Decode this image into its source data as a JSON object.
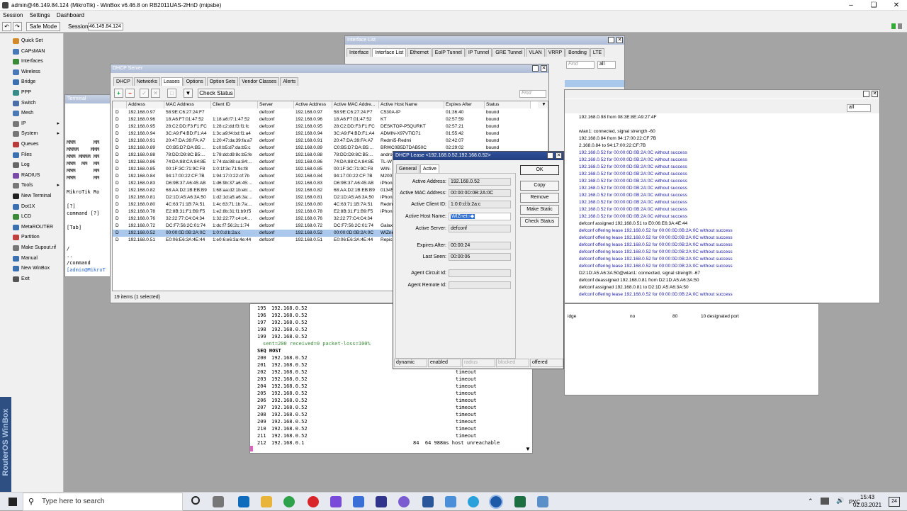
{
  "window": {
    "title": "admin@46.149.84.124 (MikroTik) - WinBox v6.46.8 on RB2011UAS-2HnD (mipsbe)"
  },
  "menu": [
    "Session",
    "Settings",
    "Dashboard"
  ],
  "toolbar": {
    "safe_mode": "Safe Mode",
    "session_label": "Session:",
    "session_value": "46.149.84.124"
  },
  "sidebar": [
    {
      "label": "Quick Set",
      "color": "#d08a2a",
      "sub": ""
    },
    {
      "label": "CAPsMAN",
      "color": "#4a79b8",
      "sub": ""
    },
    {
      "label": "Interfaces",
      "color": "#3a8a3a",
      "sub": ""
    },
    {
      "label": "Wireless",
      "color": "#4a79b8",
      "sub": ""
    },
    {
      "label": "Bridge",
      "color": "#3a6fb0",
      "sub": ""
    },
    {
      "label": "PPP",
      "color": "#3a8a8a",
      "sub": ""
    },
    {
      "label": "Switch",
      "color": "#4a6fa8",
      "sub": ""
    },
    {
      "label": "Mesh",
      "color": "#4a79b8",
      "sub": ""
    },
    {
      "label": "IP",
      "color": "#777777",
      "sub": "▸"
    },
    {
      "label": "System",
      "color": "#777777",
      "sub": "▸"
    },
    {
      "label": "Queues",
      "color": "#b83a3a",
      "sub": ""
    },
    {
      "label": "Files",
      "color": "#3a6fb0",
      "sub": ""
    },
    {
      "label": "Log",
      "color": "#666666",
      "sub": ""
    },
    {
      "label": "RADIUS",
      "color": "#7a4aa8",
      "sub": ""
    },
    {
      "label": "Tools",
      "color": "#777777",
      "sub": "▸"
    },
    {
      "label": "New Terminal",
      "color": "#222222",
      "sub": ""
    },
    {
      "label": "Dot1X",
      "color": "#3a6fb0",
      "sub": ""
    },
    {
      "label": "LCD",
      "color": "#3a8a3a",
      "sub": ""
    },
    {
      "label": "MetaROUTER",
      "color": "#3a6fb0",
      "sub": ""
    },
    {
      "label": "Partition",
      "color": "#c04040",
      "sub": ""
    },
    {
      "label": "Make Supout.rif",
      "color": "#777777",
      "sub": ""
    },
    {
      "label": "Manual",
      "color": "#3a6fb0",
      "sub": ""
    },
    {
      "label": "New WinBox",
      "color": "#3a6fb0",
      "sub": ""
    },
    {
      "label": "Exit",
      "color": "#555555",
      "sub": ""
    }
  ],
  "brand": "RouterOS WinBox",
  "iflist": {
    "title": "Interface List",
    "tabs": [
      "Interface",
      "Interface List",
      "Ethernet",
      "EoIP Tunnel",
      "IP Tunnel",
      "GRE Tunnel",
      "VLAN",
      "VRRP",
      "Bonding",
      "LTE"
    ],
    "find": "Find",
    "all": "all"
  },
  "logwin": {
    "all": "all",
    "lines": [
      {
        "t": "192.168.0.98 from 08:3E:8E:A9:27:4F",
        "c": "#000000"
      },
      {
        "t": "",
        "c": "#000000"
      },
      {
        "t": "wlan1: connected, signal strength -60",
        "c": "#000000"
      },
      {
        "t": "192.168.0.84 from 94:17:00:22:CF:7B",
        "c": "#000000"
      },
      {
        "t": "2.168.0.84 to 94:17:00:22:CF:7B",
        "c": "#000000"
      },
      {
        "t": "192.168.0.52 for 00:00:0D:0B:2A:0C without success",
        "c": "#1a1aa8"
      },
      {
        "t": "192.168.0.52 for 00:00:0D:0B:2A:0C without success",
        "c": "#1a1aa8"
      },
      {
        "t": "192.168.0.52 for 00:00:0D:0B:2A:0C without success",
        "c": "#1a1aa8"
      },
      {
        "t": "192.168.0.52 for 00:00:0D:0B:2A:0C without success",
        "c": "#1a1aa8"
      },
      {
        "t": "192.168.0.52 for 00:00:0D:0B:2A:0C without success",
        "c": "#1a1aa8"
      },
      {
        "t": "192.168.0.52 for 00:00:0D:0B:2A:0C without success",
        "c": "#1a1aa8"
      },
      {
        "t": "192.168.0.52 for 00:00:0D:0B:2A:0C without success",
        "c": "#1a1aa8"
      },
      {
        "t": "192.168.0.52 for 00:00:0D:0B:2A:0C without success",
        "c": "#1a1aa8"
      },
      {
        "t": "192.168.0.52 for 00:00:0D:0B:2A:0C without success",
        "c": "#1a1aa8"
      },
      {
        "t": "192.168.0.52 for 00:00:0D:0B:2A:0C without success",
        "c": "#1a1aa8"
      },
      {
        "t": "defconf assigned 192.168.0.51 to E0:06:E6:3A:4E:44",
        "c": "#000000"
      },
      {
        "t": "defconf offering lease 192.168.0.52 for 00:00:0D:0B:2A:0C without success",
        "c": "#1a1aa8"
      },
      {
        "t": "defconf offering lease 192.168.0.52 for 00:00:0D:0B:2A:0C without success",
        "c": "#1a1aa8"
      },
      {
        "t": "defconf offering lease 192.168.0.52 for 00:00:0D:0B:2A:0C without success",
        "c": "#1a1aa8"
      },
      {
        "t": "defconf offering lease 192.168.0.52 for 00:00:0D:0B:2A:0C without success",
        "c": "#1a1aa8"
      },
      {
        "t": "defconf offering lease 192.168.0.52 for 00:00:0D:0B:2A:0C without success",
        "c": "#1a1aa8"
      },
      {
        "t": "defconf offering lease 192.168.0.52 for 00:00:0D:0B:2A:0C without success",
        "c": "#1a1aa8"
      },
      {
        "t": "D2:1D:A5:A6:3A:50@wlan1: connected, signal strength -67",
        "c": "#000000"
      },
      {
        "t": "defconf deassigned 192.168.0.81 from D2:1D:A5:A6:3A:50",
        "c": "#000000"
      },
      {
        "t": "defconf assigned 192.168.0.81 to D2:1D:A5:A6:3A:50",
        "c": "#000000"
      },
      {
        "t": "defconf offering lease 192.168.0.52 for 00:00:0D:0B:2A:0C without success",
        "c": "#1a1aa8"
      }
    ]
  },
  "bridgerow": {
    "c1": "idge",
    "c2": "no",
    "c3": "80",
    "c4": "10 designated port"
  },
  "terminal_small": {
    "title": "Terminal",
    "lines": [
      "MMM      MM",
      "MMMM    MMM",
      "MMM MMMM MM",
      "MMM  MM  MM",
      "MMM      MM",
      "MMM      MM",
      "",
      "MikroTik Ro",
      "",
      "[?]",
      "command [?]",
      "",
      "[Tab]",
      "",
      "",
      "/",
      "..",
      "/command",
      "[admin@MikroT"
    ]
  },
  "ping": {
    "lines": [
      {
        "a": "195",
        "b": "192.168.0.52",
        "c": ""
      },
      {
        "a": "196",
        "b": "192.168.0.52",
        "c": ""
      },
      {
        "a": "197",
        "b": "192.168.0.52",
        "c": ""
      },
      {
        "a": "198",
        "b": "192.168.0.52",
        "c": ""
      },
      {
        "a": "199",
        "b": "192.168.0.52",
        "c": ""
      }
    ],
    "summary": "sent=200 received=0 packet-loss=100%",
    "header": "SEQ HOST",
    "lines2": [
      {
        "a": "200",
        "b": "192.168.0.52",
        "c": "timeout"
      },
      {
        "a": "201",
        "b": "192.168.0.52",
        "c": "timeout"
      },
      {
        "a": "202",
        "b": "192.168.0.52",
        "c": "timeout"
      },
      {
        "a": "203",
        "b": "192.168.0.52",
        "c": "timeout"
      },
      {
        "a": "204",
        "b": "192.168.0.52",
        "c": "timeout"
      },
      {
        "a": "205",
        "b": "192.168.0.52",
        "c": "timeout"
      },
      {
        "a": "206",
        "b": "192.168.0.52",
        "c": "timeout"
      },
      {
        "a": "207",
        "b": "192.168.0.52",
        "c": "timeout"
      },
      {
        "a": "208",
        "b": "192.168.0.52",
        "c": "timeout"
      },
      {
        "a": "209",
        "b": "192.168.0.52",
        "c": "timeout"
      },
      {
        "a": "210",
        "b": "192.168.0.52",
        "c": "timeout"
      },
      {
        "a": "211",
        "b": "192.168.0.52",
        "c": "timeout"
      }
    ],
    "last": {
      "a": "212",
      "b": "192.168.0.1",
      "c": "84  64 988ms host unreachable"
    }
  },
  "dhcp": {
    "title": "DHCP Server",
    "tabs": [
      "DHCP",
      "Networks",
      "Leases",
      "Options",
      "Option Sets",
      "Vendor Classes",
      "Alerts"
    ],
    "check_status": "Check Status",
    "find": "Find",
    "columns": [
      "Address",
      "MAC Address",
      "Client ID",
      "Server",
      "Active Address",
      "Active MAC Addre...",
      "Active Host Name",
      "Expires After",
      "Status"
    ],
    "rows": [
      [
        "D",
        "192.168.0.97",
        "58:9E:C6:27:24:F7",
        "",
        "defconf",
        "192.168.0.97",
        "58:9E:C6:27:24:F7",
        "C530A-IP",
        "01:36:40",
        "bound"
      ],
      [
        "D",
        "192.168.0.96",
        "18:A6:F7:01:47:52",
        "1:18:a6:f7:1:47:52",
        "defconf",
        "192.168.0.96",
        "18:A6:F7:01:47:52",
        "KT",
        "02:57:59",
        "bound"
      ],
      [
        "D",
        "192.168.0.95",
        "28:C2:DD:F3:F1:FC",
        "1:28:c2:dd:f3:f1:fc",
        "defconf",
        "192.168.0.95",
        "28:C2:DD:F3:F1:FC",
        "DESKTOP-P5QURKT",
        "02:57:21",
        "bound"
      ],
      [
        "D",
        "192.168.0.94",
        "3C:A9:F4:BD:F1:A4",
        "1:3c:a9:f4:bd:f1:a4",
        "defconf",
        "192.168.0.94",
        "3C:A9:F4:BD:F1:A4",
        "ADMIN-X97VTID71",
        "01:55:42",
        "bound"
      ],
      [
        "D",
        "192.168.0.91",
        "20:47:DA:39:FA:A7",
        "1:20:47:da:39:fa:a7",
        "defconf",
        "192.168.0.91",
        "20:47:DA:39:FA:A7",
        "Redmi5-Redmi",
        "02:42:07",
        "bound"
      ],
      [
        "D",
        "192.168.0.89",
        "C0:B5:D7:DA:B5:...",
        "1:c0:b5:d7:da:b5:c",
        "defconf",
        "192.168.0.89",
        "C0:B5:D7:DA:B5:...",
        "BRWC0B5D7DAB50C",
        "02:29:02",
        "bound"
      ],
      [
        "D",
        "192.168.0.88",
        "78:DD:D9:8C:B5:...",
        "1:78:dd:d9:8c:b5:fe",
        "defconf",
        "192.168.0.88",
        "78:DD:D9:8C:B5:...",
        "andro",
        "",
        ""
      ],
      [
        "D",
        "192.168.0.86",
        "74:DA:88:CA:84:8E",
        "1:74:da:88:ca:84:...",
        "defconf",
        "192.168.0.86",
        "74:DA:88:CA:84:8E",
        "TL-W",
        "",
        ""
      ],
      [
        "D",
        "192.168.0.85",
        "00:1F:3C:71:9C:F8",
        "1:0:1f:3c:71:9c:f8",
        "defconf",
        "192.168.0.85",
        "00:1F:3C:71:9C:F8",
        "WIN-",
        "",
        ""
      ],
      [
        "D",
        "192.168.0.84",
        "94:17:00:22:CF:7B",
        "1:94:17:0:22:cf:7b",
        "defconf",
        "192.168.0.84",
        "94:17:00:22:CF:7B",
        "M200",
        "",
        ""
      ],
      [
        "D",
        "192.168.0.83",
        "D6:9B:37:A6:45:AB",
        "1:d6:9b:37:a6:45:...",
        "defconf",
        "192.168.0.83",
        "D6:9B:37:A6:45:AB",
        "iPhon",
        "",
        ""
      ],
      [
        "D",
        "192.168.0.82",
        "68:AA:D2:1B:EB:B9",
        "1:68:aa:d2:1b:eb:...",
        "defconf",
        "192.168.0.82",
        "68:AA:D2:1B:EB:B9",
        "01345",
        "",
        ""
      ],
      [
        "D",
        "192.168.0.81",
        "D2:1D:A5:A6:3A:50",
        "1:d2:1d:a5:a6:3a:...",
        "defconf",
        "192.168.0.81",
        "D2:1D:A5:A6:3A:50",
        "iPhon",
        "",
        ""
      ],
      [
        "D",
        "192.168.0.80",
        "4C:63:71:1B:7A:51",
        "1:4c:63:71:1b:7a:...",
        "defconf",
        "192.168.0.80",
        "4C:63:71:1B:7A:51",
        "Redmi",
        "",
        ""
      ],
      [
        "D",
        "192.168.0.78",
        "E2:8B:31:F1:B9:F5",
        "1:e2:8b:31:f1:b9:f5",
        "defconf",
        "192.168.0.78",
        "E2:8B:31:F1:B9:F5",
        "iPhon",
        "",
        ""
      ],
      [
        "D",
        "192.168.0.76",
        "32:22:77:C4:C4:34",
        "1:32:22:77:c4:c4:...",
        "defconf",
        "192.168.0.76",
        "32:22:77:C4:C4:34",
        "",
        "",
        ""
      ],
      [
        "D",
        "192.168.0.72",
        "DC:F7:56:2C:01:74",
        "1:dc:f7:56:2c:1:74",
        "defconf",
        "192.168.0.72",
        "DC:F7:56:2C:01:74",
        "Galax",
        "",
        ""
      ],
      [
        "D",
        "192.168.0.52",
        "00:00:0D:0B:2A:0C",
        "1:0:0:d:b:2a:c",
        "defconf",
        "192.168.0.52",
        "00:00:0D:0B:2A:0C",
        "WIZne",
        "",
        ""
      ],
      [
        "D",
        "192.168.0.51",
        "E0:06:E6:3A:4E:44",
        "1:e0:6:e6:3a:4e:44",
        "defconf",
        "192.168.0.51",
        "E0:06:E6:3A:4E:44",
        "Repic",
        "",
        ""
      ]
    ],
    "footer": "19 items (1 selected)"
  },
  "lease": {
    "title": "DHCP Lease <192.168.0.52,192.168.0.52>",
    "tabs": [
      "General",
      "Active"
    ],
    "fields": [
      {
        "label": "Active Address:",
        "value": "192.168.0.52"
      },
      {
        "label": "Active MAC Address:",
        "value": "00:00:0D:0B:2A:0C"
      },
      {
        "label": "Active Client ID:",
        "value": "1:0:0:d:b:2a:c"
      },
      {
        "label": "Active Host Name:",
        "value": "WIZnet○◆"
      },
      {
        "label": "Active Server:",
        "value": "defconf"
      },
      {
        "label": "Expires After:",
        "value": "00:00:24"
      },
      {
        "label": "Last Seen:",
        "value": "00:00:06"
      },
      {
        "label": "Agent Circuit Id:",
        "value": ""
      },
      {
        "label": "Agent Remote Id:",
        "value": ""
      }
    ],
    "buttons": [
      "OK",
      "Copy",
      "Remove",
      "Make Static",
      "Check Status"
    ],
    "status": [
      "dynamic",
      "enabled",
      "radius",
      "blocked",
      "offered"
    ]
  },
  "taskbar": {
    "search": "Type here to search",
    "lang": "РУС",
    "time": "15:43",
    "date": "02.03.2021",
    "notif": "24"
  }
}
